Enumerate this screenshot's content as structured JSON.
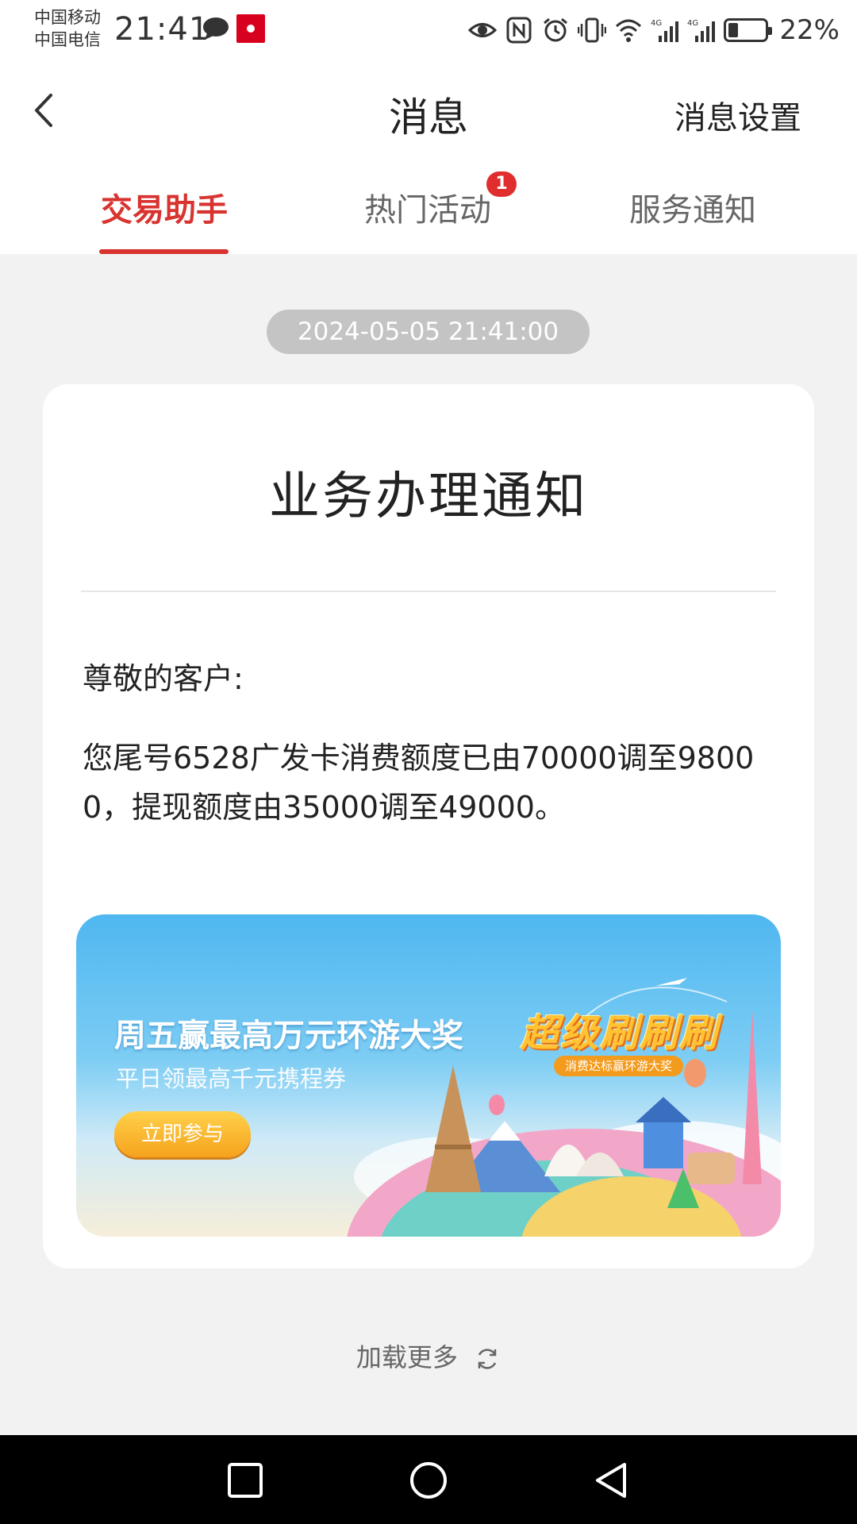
{
  "status_bar": {
    "carrier_1": "中国移动",
    "carrier_2": "中国电信",
    "time": "21:41",
    "battery_pct": "22%",
    "icons": [
      "chat-icon",
      "app-notification-icon",
      "eye-icon",
      "nfc-icon",
      "alarm-icon",
      "vibrate-icon",
      "wifi-icon",
      "signal-4g-icon",
      "signal-4g-icon",
      "battery-icon"
    ]
  },
  "header": {
    "title": "消息",
    "settings_label": "消息设置"
  },
  "tabs": [
    {
      "label": "交易助手",
      "active": true
    },
    {
      "label": "热门活动",
      "active": false,
      "badge": "1"
    },
    {
      "label": "服务通知",
      "active": false
    }
  ],
  "message": {
    "timestamp": "2024-05-05 21:41:00",
    "title": "业务办理通知",
    "greeting": "尊敬的客户:",
    "body": "您尾号6528广发卡消费额度已由70000调至98000，提现额度由35000调至49000。"
  },
  "banner": {
    "headline": "周五赢最高万元环游大奖",
    "subline": "平日领最高千元携程券",
    "button_label": "立即参与",
    "logo_text": "超级刷刷刷",
    "logo_sub": "消费达标赢环游大奖"
  },
  "load_more": "加载更多",
  "colors": {
    "accent": "#d8332f",
    "badge": "#e02e2e",
    "page_bg": "#f2f2f2"
  }
}
